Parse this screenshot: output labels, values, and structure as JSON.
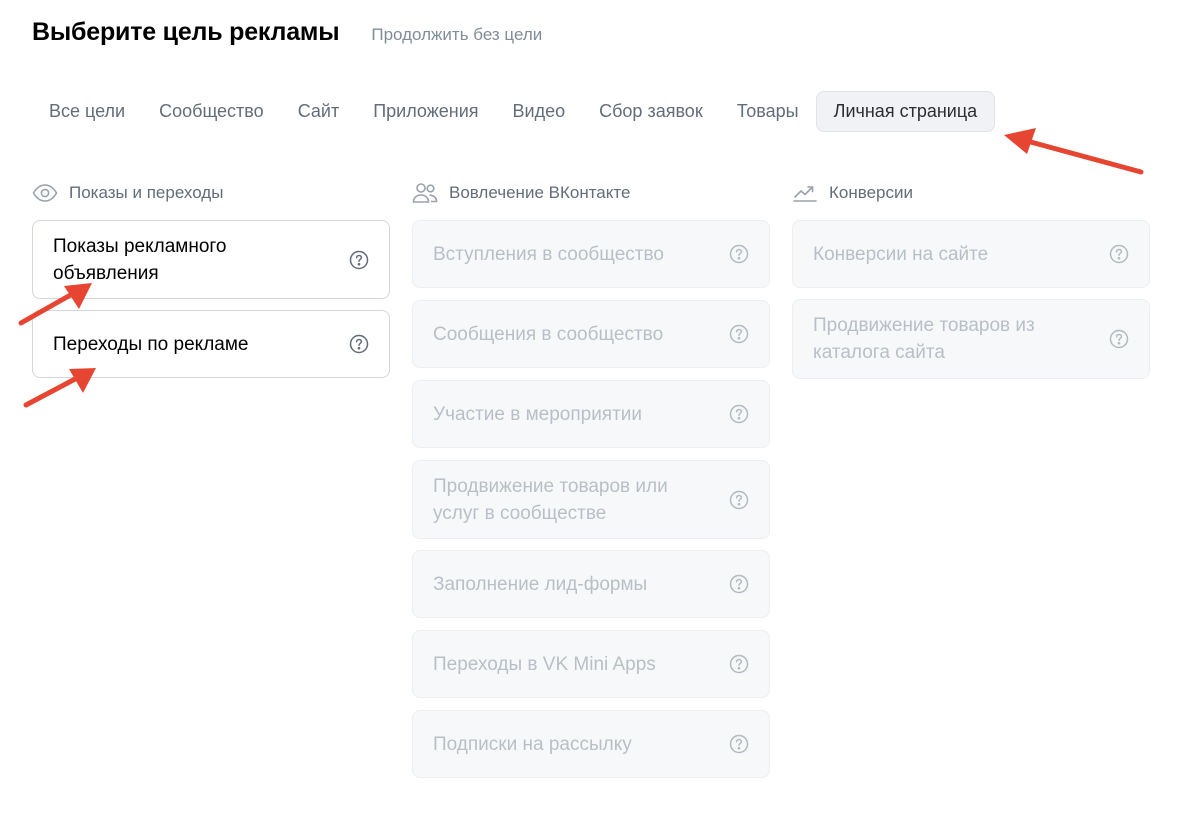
{
  "header": {
    "title": "Выберите цель рекламы",
    "skip_label": "Продолжить без цели"
  },
  "tabs": [
    {
      "label": "Все цели",
      "active": false
    },
    {
      "label": "Сообщество",
      "active": false
    },
    {
      "label": "Сайт",
      "active": false
    },
    {
      "label": "Приложения",
      "active": false
    },
    {
      "label": "Видео",
      "active": false
    },
    {
      "label": "Сбор заявок",
      "active": false
    },
    {
      "label": "Товары",
      "active": false
    },
    {
      "label": "Личная страница",
      "active": true
    }
  ],
  "columns": [
    {
      "title": "Показы и переходы",
      "icon": "eye-icon",
      "items": [
        {
          "label": "Показы рекламного объявления",
          "enabled": true
        },
        {
          "label": "Переходы по рекламе",
          "enabled": true
        }
      ]
    },
    {
      "title": "Вовлечение ВКонтакте",
      "icon": "users-icon",
      "items": [
        {
          "label": "Вступления в сообщество",
          "enabled": false
        },
        {
          "label": "Сообщения в сообщество",
          "enabled": false
        },
        {
          "label": "Участие в мероприятии",
          "enabled": false
        },
        {
          "label": "Продвижение товаров или услуг в сообществе",
          "enabled": false
        },
        {
          "label": "Заполнение лид-формы",
          "enabled": false
        },
        {
          "label": "Переходы в VK Mini Apps",
          "enabled": false
        },
        {
          "label": "Подписки на рассылку",
          "enabled": false
        }
      ]
    },
    {
      "title": "Конверсии",
      "icon": "trend-up-icon",
      "items": [
        {
          "label": "Конверсии на сайте",
          "enabled": false
        },
        {
          "label": "Продвижение товаров из каталога сайта",
          "enabled": false
        }
      ]
    }
  ],
  "colors": {
    "active_tab_bg": "#f0f2f5",
    "muted_text": "#818c99",
    "disabled_text": "#b9bfc7",
    "annotation_arrow": "#e64631"
  }
}
